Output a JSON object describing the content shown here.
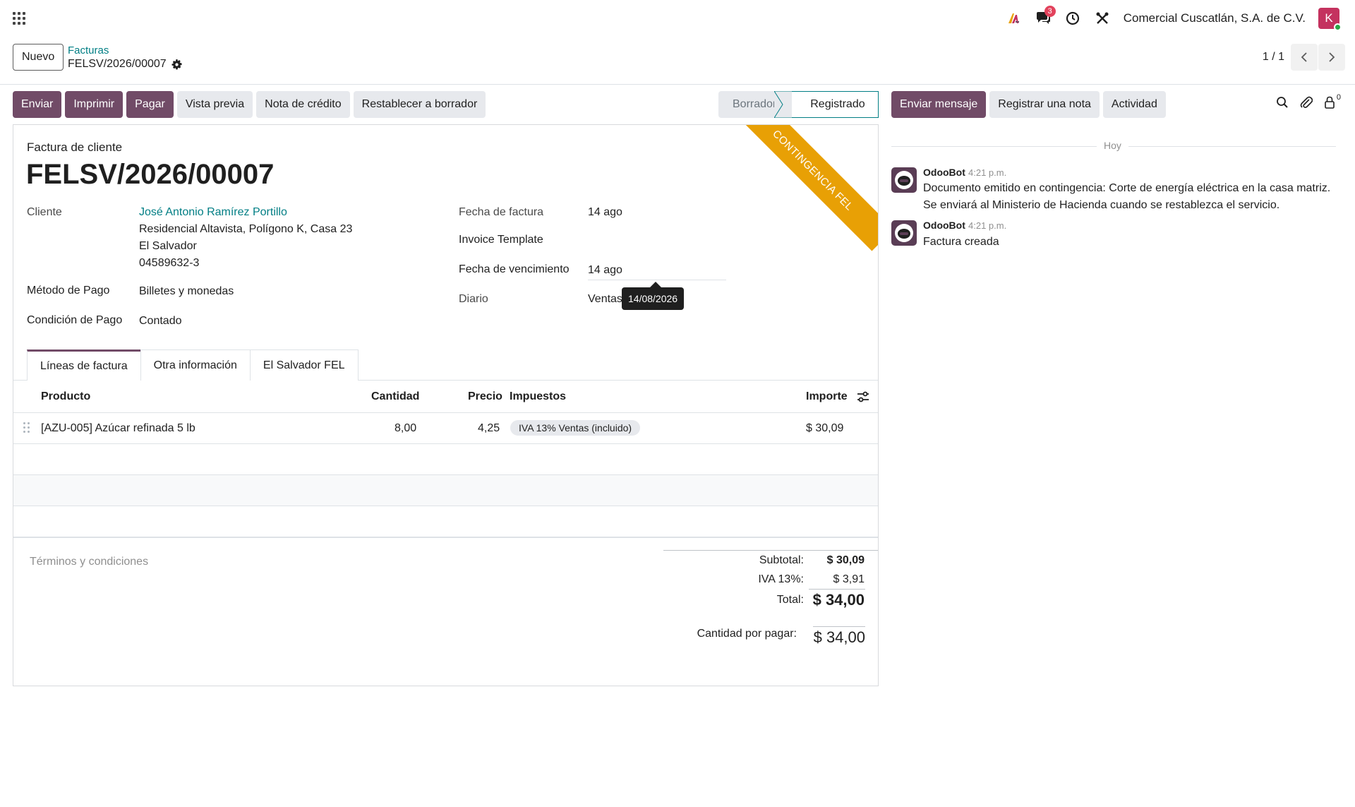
{
  "navbar": {
    "notification_count": "3",
    "company": "Comercial Cuscatlán, S.A. de C.V.",
    "user_initial": "K"
  },
  "control": {
    "new_label": "Nuevo",
    "breadcrumb_parent": "Facturas",
    "breadcrumb_current": "FELSV/2026/00007",
    "pager": "1 / 1"
  },
  "actions": {
    "send": "Enviar",
    "print": "Imprimir",
    "pay": "Pagar",
    "preview": "Vista previa",
    "credit_note": "Nota de crédito",
    "reset_draft": "Restablecer a borrador"
  },
  "status": {
    "draft": "Borrador",
    "posted": "Registrado"
  },
  "form": {
    "ribbon": "CONTINGENCIA FEL",
    "doc_type": "Factura de cliente",
    "doc_name": "FELSV/2026/00007",
    "customer_label": "Cliente",
    "customer_name": "José Antonio Ramírez Portillo",
    "customer_address1": "Residencial Altavista, Polígono K, Casa 23",
    "customer_country": "El Salvador",
    "customer_vat": "04589632-3",
    "payment_method_label": "Método de Pago",
    "payment_method": "Billetes y monedas",
    "payment_condition_label": "Condición de Pago",
    "payment_condition": "Contado",
    "invoice_date_label": "Fecha de factura",
    "invoice_date": "14 ago",
    "invoice_template_label": "Invoice Template",
    "due_date_label": "Fecha de vencimiento",
    "due_date": "14 ago",
    "journal_label": "Diario",
    "journal": "Ventas",
    "tooltip": "14/08/2026"
  },
  "tabs": [
    "Líneas de factura",
    "Otra información",
    "El Salvador FEL"
  ],
  "table": {
    "headers": {
      "product": "Producto",
      "quantity": "Cantidad",
      "price": "Precio",
      "taxes": "Impuestos",
      "amount": "Importe"
    },
    "rows": [
      {
        "product": "[AZU-005] Azúcar refinada 5 lb",
        "quantity": "8,00",
        "price": "4,25",
        "tax": "IVA 13% Ventas (incluido)",
        "amount": "$ 30,09"
      }
    ]
  },
  "footer": {
    "terms_placeholder": "Términos y condiciones",
    "subtotal_label": "Subtotal:",
    "subtotal": "$ 30,09",
    "iva_label": "IVA 13%:",
    "iva": "$ 3,91",
    "total_label": "Total:",
    "total": "$ 34,00",
    "due_label": "Cantidad por pagar:",
    "due": "$ 34,00"
  },
  "chatter": {
    "send_message": "Enviar mensaje",
    "log_note": "Registrar una nota",
    "activity": "Actividad",
    "followers_count": "0",
    "today": "Hoy",
    "messages": [
      {
        "author": "OdooBot",
        "time": "4:21 p.m.",
        "body": "Documento emitido en contingencia: Corte de energía eléctrica en la casa matriz. Se enviará al Ministerio de Hacienda cuando se restablezca el servicio."
      },
      {
        "author": "OdooBot",
        "time": "4:21 p.m.",
        "body": "Factura creada"
      }
    ]
  },
  "colors": {
    "primary": "#714b67",
    "link": "#017e84",
    "ribbon": "#e8a005"
  }
}
